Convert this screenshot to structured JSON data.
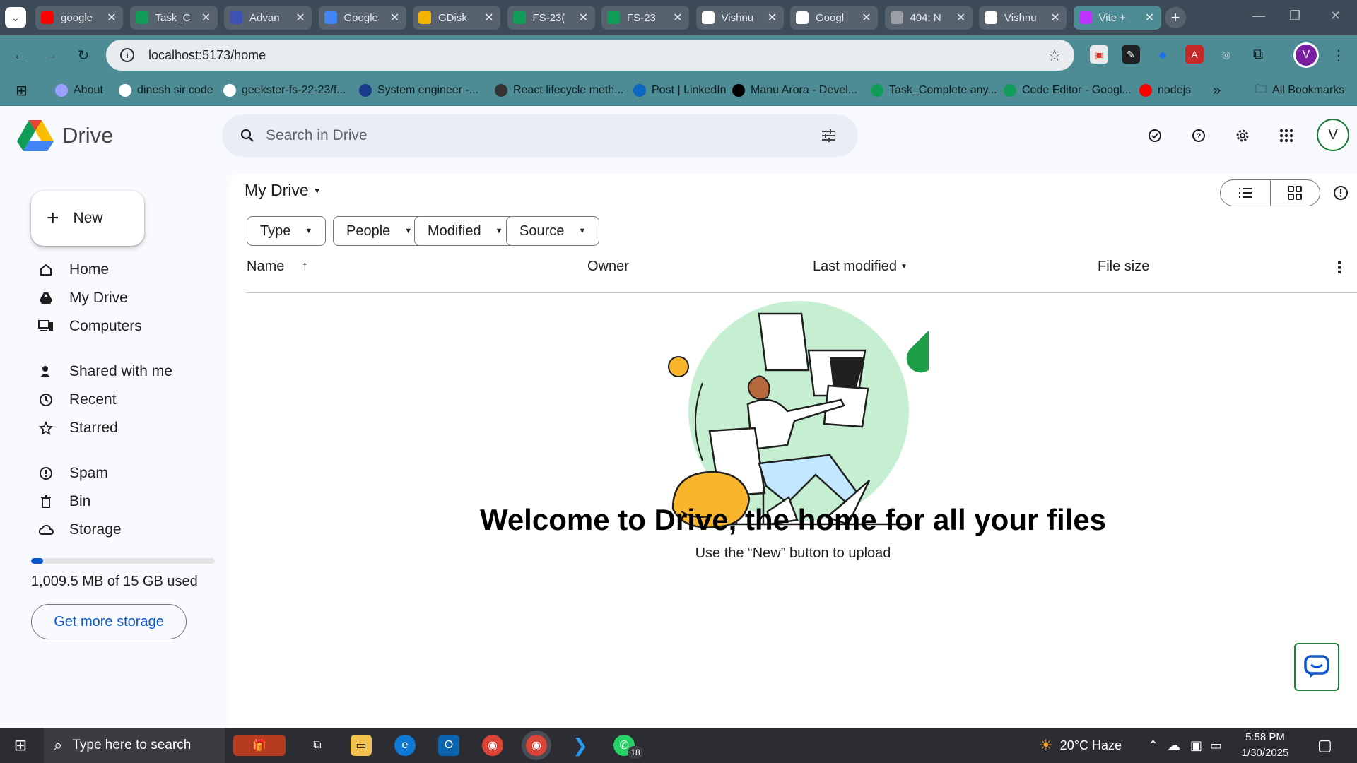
{
  "browser": {
    "tabs": [
      {
        "title": "google",
        "color": "#ff0000"
      },
      {
        "title": "Task_C",
        "color": "#0f9d58"
      },
      {
        "title": "Advan",
        "color": "#3f51b5"
      },
      {
        "title": "Google",
        "color": "#4285f4"
      },
      {
        "title": "GDisk",
        "color": "#f4b400"
      },
      {
        "title": "FS-23(",
        "color": "#0f9d58"
      },
      {
        "title": "FS-23",
        "color": "#0f9d58"
      },
      {
        "title": "Vishnu",
        "color": "#ffffff"
      },
      {
        "title": "Googl",
        "color": "#ffffff"
      },
      {
        "title": "404: N",
        "color": "#9aa0a6"
      },
      {
        "title": "Vishnu",
        "color": "#ffffff"
      },
      {
        "title": "Vite +",
        "color": "#bd34fe"
      }
    ],
    "url": "localhost:5173/home",
    "profile_initial": "V",
    "bookmarks": [
      {
        "label": "About",
        "color": "#9aa0ff"
      },
      {
        "label": "dinesh sir code",
        "color": "#ffffff"
      },
      {
        "label": "geekster-fs-22-23/f...",
        "color": "#ffffff"
      },
      {
        "label": "System engineer -...",
        "color": "#1a3a8a"
      },
      {
        "label": "React lifecycle meth...",
        "color": "#333333"
      },
      {
        "label": "Post | LinkedIn",
        "color": "#0a66c2"
      },
      {
        "label": "Manu Arora - Devel...",
        "color": "#000000"
      },
      {
        "label": "Task_Complete any...",
        "color": "#0f9d58"
      },
      {
        "label": "Code Editor - Googl...",
        "color": "#0f9d58"
      },
      {
        "label": "nodejs",
        "color": "#ff0000"
      }
    ],
    "all_bookmarks": "All Bookmarks",
    "more": "»"
  },
  "drive": {
    "logo_text": "Drive",
    "search_placeholder": "Search in Drive",
    "avatar_initial": "V",
    "new_label": "New",
    "nav": [
      {
        "label": "Home",
        "icon": "home-icon"
      },
      {
        "label": "My Drive",
        "icon": "my-drive-icon"
      },
      {
        "label": "Computers",
        "icon": "computers-icon"
      },
      {
        "label": "Shared with me",
        "icon": "shared-icon"
      },
      {
        "label": "Recent",
        "icon": "clock-icon"
      },
      {
        "label": "Starred",
        "icon": "star-icon"
      },
      {
        "label": "Spam",
        "icon": "spam-icon"
      },
      {
        "label": "Bin",
        "icon": "bin-icon"
      },
      {
        "label": "Storage",
        "icon": "cloud-icon"
      }
    ],
    "storage_fraction": 0.066,
    "storage_text": "1,009.5 MB of 15 GB used",
    "get_more_label": "Get more storage",
    "page_title": "My Drive",
    "filters": [
      "Type",
      "People",
      "Modified",
      "Source"
    ],
    "columns": {
      "name": "Name",
      "owner": "Owner",
      "modified": "Last modified",
      "size": "File size"
    },
    "welcome_title": "Welcome to Drive, the home for all your files",
    "welcome_sub": "Use the “New” button to upload"
  },
  "taskbar": {
    "search_placeholder": "Type here to search",
    "weather": "20°C  Haze",
    "time": "5:58 PM",
    "date": "1/30/2025",
    "whatsapp_badge": "18"
  },
  "colors": {
    "accent_blue": "#0b57d0",
    "green": "#188038",
    "tab_bar": "#3c4b57",
    "toolbar": "#4d8c95"
  }
}
